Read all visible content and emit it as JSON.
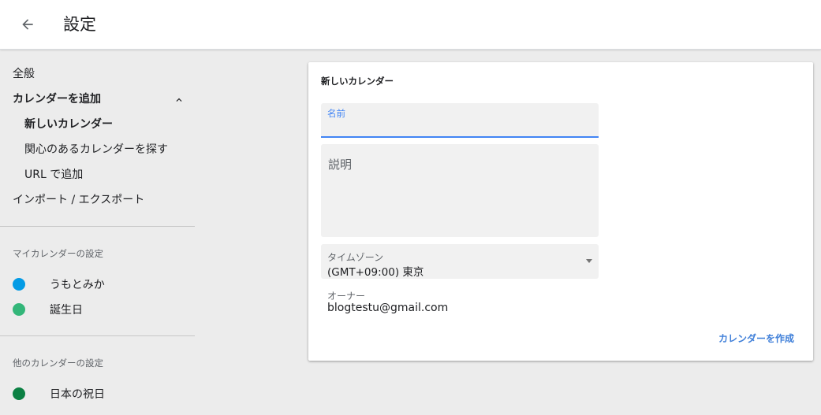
{
  "header": {
    "back_icon": "arrow-left-icon",
    "title": "設定"
  },
  "sidebar": {
    "items": [
      {
        "label": "全般"
      },
      {
        "label": "カレンダーを追加"
      },
      {
        "label": "新しいカレンダー"
      },
      {
        "label": "関心のあるカレンダーを探す"
      },
      {
        "label": "URL で追加"
      },
      {
        "label": "インポート / エクスポート"
      }
    ],
    "collapse_icon": "chevron-up-icon",
    "my_calendars": {
      "title": "マイカレンダーの設定",
      "items": [
        {
          "label": "うもとみか",
          "color": "#039be5"
        },
        {
          "label": "誕生日",
          "color": "#33b679"
        }
      ]
    },
    "other_calendars": {
      "title": "他のカレンダーの設定",
      "items": [
        {
          "label": "日本の祝日",
          "color": "#0b8043"
        }
      ]
    }
  },
  "form": {
    "title": "新しいカレンダー",
    "name_label": "名前",
    "name_value": "",
    "description_placeholder": "説明",
    "timezone_label": "タイムゾーン",
    "timezone_value": "(GMT+09:00) 東京",
    "owner_label": "オーナー",
    "owner_value": "blogtestu@gmail.com",
    "create_button": "カレンダーを作成"
  },
  "colors": {
    "accent": "#4285f4",
    "link": "#3f7fd9"
  }
}
